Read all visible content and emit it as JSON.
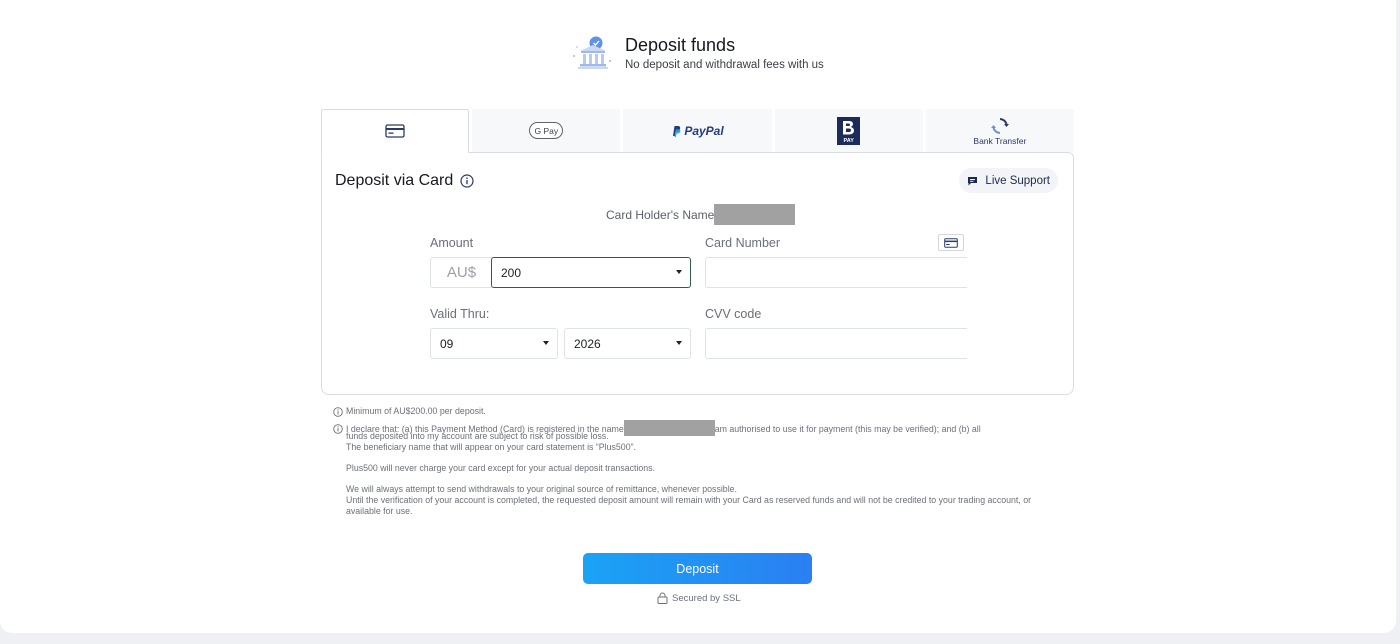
{
  "header": {
    "title": "Deposit funds",
    "subtitle": "No deposit and withdrawal fees with us",
    "icon": "bank-icon"
  },
  "tabs": [
    {
      "name": "card",
      "icon": "credit-card-icon",
      "label": "",
      "active": true
    },
    {
      "name": "google-pay",
      "icon": "google-pay-logo",
      "label": "G Pay",
      "active": false
    },
    {
      "name": "paypal",
      "icon": "paypal-logo",
      "label": "PayPal",
      "active": false
    },
    {
      "name": "bpay",
      "icon": "bpay-logo",
      "label": "PAY",
      "active": false
    },
    {
      "name": "bank-transfer",
      "icon": "bank-transfer-icon",
      "label": "Bank Transfer",
      "active": false
    }
  ],
  "panel": {
    "title": "Deposit via Card",
    "live_support": "Live Support",
    "holder_label": "Card Holder's Name",
    "amount_label": "Amount",
    "currency": "AU$",
    "amount_value": "200",
    "card_number_label": "Card Number",
    "card_number_value": "",
    "valid_thru_label": "Valid Thru:",
    "month_value": "09",
    "year_value": "2026",
    "cvv_label": "CVV code",
    "cvv_value": ""
  },
  "notes": {
    "minimum": "Minimum of AU$200.00 per deposit.",
    "declare_start": "I declare that: (a) this Payment Method (Card) is registered in the name",
    "declare_end": "am authorised to use it for payment (this may be verified); and (b) all",
    "declare_line2": "funds deposited into my account are subject to risk of possible loss.",
    "beneficiary": "The beneficiary name that will appear on your card statement is “Plus500”.",
    "never_charge": "Plus500 will never charge your card except for your actual deposit transactions.",
    "withdrawals": "We will always attempt to send withdrawals to your original source of remittance, whenever possible.",
    "verification": "Until the verification of your account is completed, the requested deposit amount will remain with your Card as reserved funds and will not be credited to your trading account, or available for use."
  },
  "deposit_button": "Deposit",
  "ssl_label": "Secured by SSL",
  "colors": {
    "accent": "#1aa3f5",
    "paypal_dark": "#253b80",
    "paypal_light": "#179bd7",
    "bpay": "#1c2b5a"
  }
}
